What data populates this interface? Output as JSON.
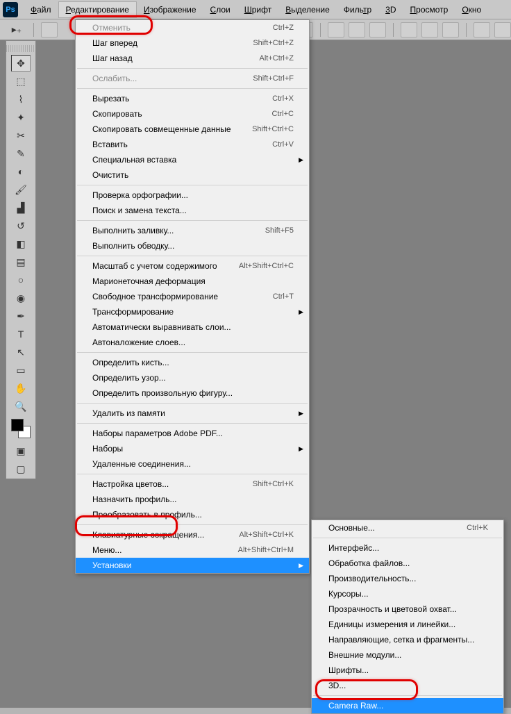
{
  "app": {
    "logo": "Ps"
  },
  "menubar": [
    {
      "label": "Файл",
      "u": "Ф"
    },
    {
      "label": "Редактирование",
      "u": "Р"
    },
    {
      "label": "Изображение",
      "u": "И"
    },
    {
      "label": "Слои",
      "u": "С"
    },
    {
      "label": "Шрифт",
      "u": "Ш"
    },
    {
      "label": "Выделение",
      "u": "В"
    },
    {
      "label": "Фильтр",
      "u": "т"
    },
    {
      "label": "3D",
      "u": "3"
    },
    {
      "label": "Просмотр",
      "u": "П"
    },
    {
      "label": "Окно",
      "u": "О"
    }
  ],
  "edit_menu": [
    {
      "label": "Отменить",
      "shortcut": "Ctrl+Z",
      "disabled": true
    },
    {
      "label": "Шаг вперед",
      "shortcut": "Shift+Ctrl+Z"
    },
    {
      "label": "Шаг назад",
      "shortcut": "Alt+Ctrl+Z"
    },
    {
      "sep": true
    },
    {
      "label": "Ослабить...",
      "shortcut": "Shift+Ctrl+F",
      "disabled": true
    },
    {
      "sep": true
    },
    {
      "label": "Вырезать",
      "shortcut": "Ctrl+X"
    },
    {
      "label": "Скопировать",
      "shortcut": "Ctrl+C"
    },
    {
      "label": "Скопировать совмещенные данные",
      "shortcut": "Shift+Ctrl+C"
    },
    {
      "label": "Вставить",
      "shortcut": "Ctrl+V"
    },
    {
      "label": "Специальная вставка",
      "arrow": true
    },
    {
      "label": "Очистить"
    },
    {
      "sep": true
    },
    {
      "label": "Проверка орфографии..."
    },
    {
      "label": "Поиск и замена текста..."
    },
    {
      "sep": true
    },
    {
      "label": "Выполнить заливку...",
      "shortcut": "Shift+F5"
    },
    {
      "label": "Выполнить обводку..."
    },
    {
      "sep": true
    },
    {
      "label": "Масштаб с учетом содержимого",
      "shortcut": "Alt+Shift+Ctrl+C"
    },
    {
      "label": "Марионеточная деформация"
    },
    {
      "label": "Свободное трансформирование",
      "shortcut": "Ctrl+T"
    },
    {
      "label": "Трансформирование",
      "arrow": true
    },
    {
      "label": "Автоматически выравнивать слои..."
    },
    {
      "label": "Автоналожение слоев..."
    },
    {
      "sep": true
    },
    {
      "label": "Определить кисть..."
    },
    {
      "label": "Определить узор..."
    },
    {
      "label": "Определить произвольную фигуру..."
    },
    {
      "sep": true
    },
    {
      "label": "Удалить из памяти",
      "arrow": true
    },
    {
      "sep": true
    },
    {
      "label": "Наборы параметров Adobe PDF..."
    },
    {
      "label": "Наборы",
      "arrow": true
    },
    {
      "label": "Удаленные соединения..."
    },
    {
      "sep": true
    },
    {
      "label": "Настройка цветов...",
      "shortcut": "Shift+Ctrl+K"
    },
    {
      "label": "Назначить профиль..."
    },
    {
      "label": "Преобразовать в профиль..."
    },
    {
      "sep": true
    },
    {
      "label": "Клавиатурные сокращения...",
      "shortcut": "Alt+Shift+Ctrl+K"
    },
    {
      "label": "Меню...",
      "shortcut": "Alt+Shift+Ctrl+M"
    },
    {
      "label": "Установки",
      "arrow": true,
      "highlight": true
    }
  ],
  "presets_submenu": [
    {
      "label": "Основные...",
      "shortcut": "Ctrl+K"
    },
    {
      "sep": true
    },
    {
      "label": "Интерфейс..."
    },
    {
      "label": "Обработка файлов..."
    },
    {
      "label": "Производительность..."
    },
    {
      "label": "Курсоры..."
    },
    {
      "label": "Прозрачность и цветовой охват..."
    },
    {
      "label": "Единицы измерения и линейки..."
    },
    {
      "label": "Направляющие, сетка и фрагменты..."
    },
    {
      "label": "Внешние модули..."
    },
    {
      "label": "Шрифты..."
    },
    {
      "label": "3D..."
    },
    {
      "sep": true
    },
    {
      "label": "Camera Raw...",
      "highlight": true
    }
  ],
  "tools": {
    "items": [
      "move",
      "marquee",
      "lasso",
      "wand",
      "crop",
      "eyedropper",
      "spot-heal",
      "brush",
      "stamp",
      "history",
      "eraser",
      "gradient",
      "blur",
      "dodge",
      "pen",
      "type",
      "path",
      "shape",
      "hand",
      "zoom"
    ]
  }
}
